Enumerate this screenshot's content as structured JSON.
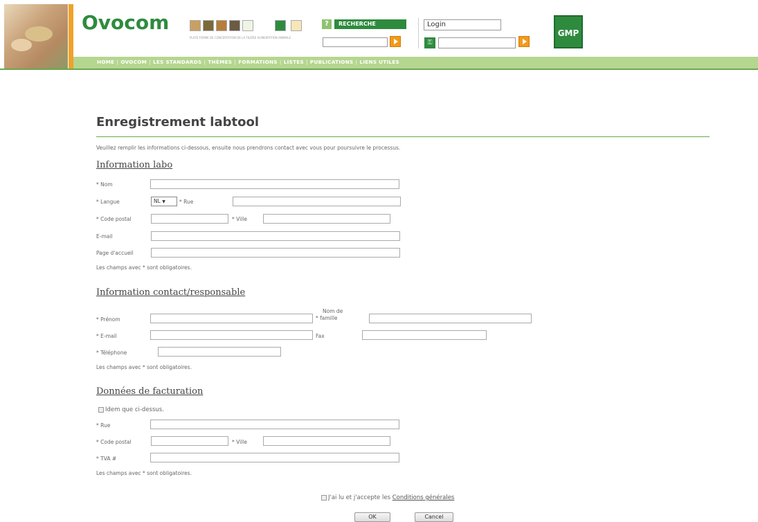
{
  "header": {
    "logo_text": "Ovocom",
    "tagline": "PLATE-FORME DE CONCERTATION DE LA FILIÈRE ALIMENTATION ANIMALE",
    "search_label": "RECHERCHE",
    "help_label": "?",
    "search_placeholder": "",
    "login_value": "Login",
    "password_value": "",
    "gmp_label": "GMP",
    "key_icon": "key-icon"
  },
  "nav": {
    "items": [
      "HOME",
      "OVOCOM",
      "LES STANDARDS",
      "THÈMES",
      "FORMATIONS",
      "LISTES",
      "PUBLICATIONS",
      "LIENS UTILES"
    ]
  },
  "form": {
    "title": "Enregistrement labtool",
    "intro": "Veuillez remplir les informations ci-dessous, ensuite nous prendrons contact avec vous pour poursuivre le processus.",
    "lab": {
      "heading": "Information labo",
      "nom_label": "* Nom",
      "langue_label": "* Langue",
      "langue_value": "NL",
      "rue_label": "* Rue",
      "code_postal_label": "* Code postal",
      "ville_label": "* Ville",
      "email_label": "E-mail",
      "page_label": "Page d'accueil",
      "required_note": "Les champs avec * sont obligatoires."
    },
    "contact": {
      "heading": "Information contact/responsable",
      "prenom_label": "* Prénom",
      "nom_famille_label_1": "Nom de",
      "nom_famille_label_2": "* famille",
      "email_label": "* E-mail",
      "fax_label": "Fax",
      "telephone_label": "* Téléphone",
      "required_note": "Les champs avec * sont obligatoires."
    },
    "billing": {
      "heading": "Données de facturation",
      "same_label": "Idem que ci-dessus.",
      "rue_label": "* Rue",
      "code_postal_label": "* Code postal",
      "ville_label": "* Ville",
      "tva_label": "* TVA #",
      "required_note": "Les champs avec * sont obligatoires."
    },
    "terms_prefix": "J'ai lu et j'accepte les",
    "terms_link": "Conditions générales",
    "ok_label": "OK",
    "cancel_label": "Cancel"
  },
  "colors": {
    "brand_green": "#2e8b3e",
    "nav_green": "#b5d68f",
    "accent_orange": "#f0a22a"
  }
}
